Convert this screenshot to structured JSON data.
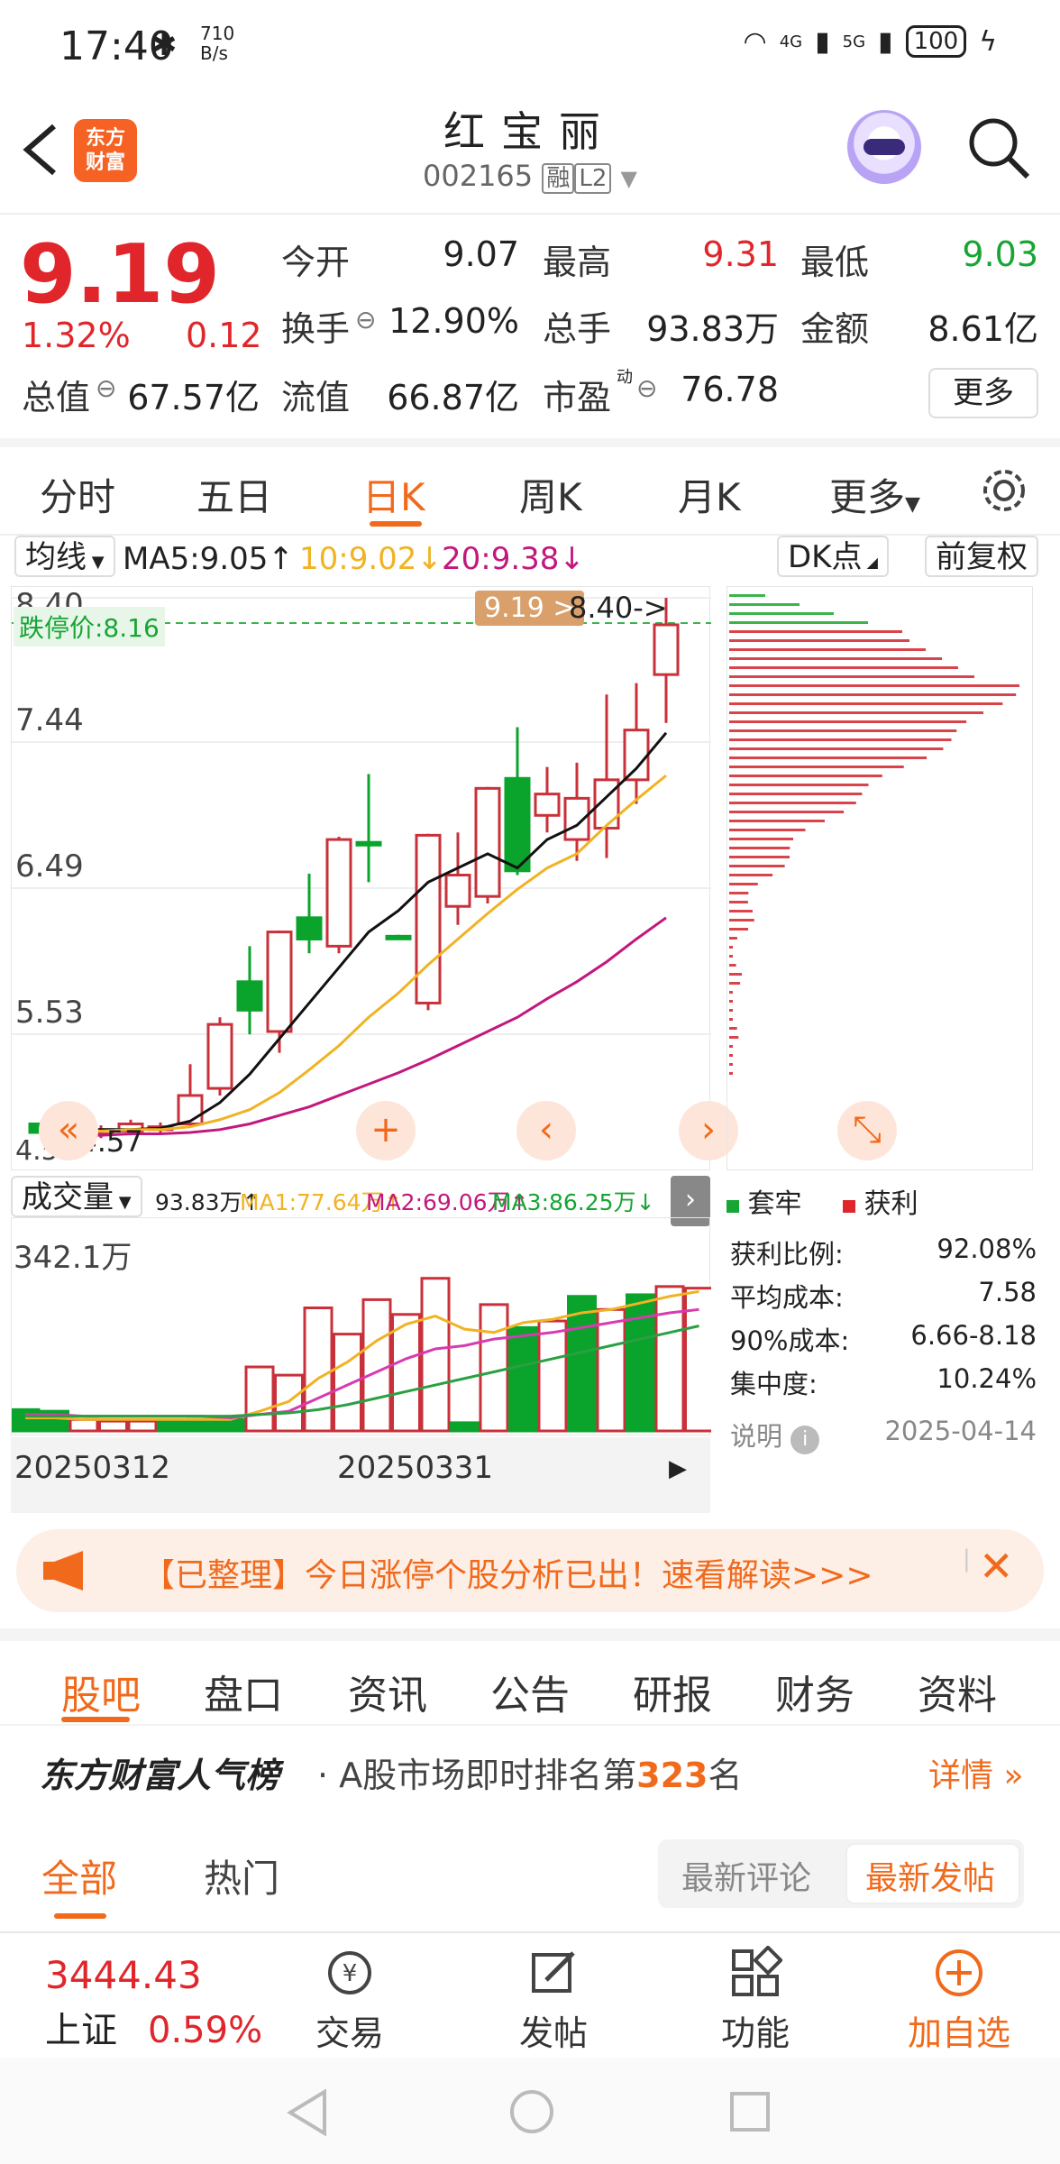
{
  "status": {
    "time": "17:40",
    "net_speed": "710\nB/s",
    "battery": "100",
    "sig1": "4G",
    "sig2": "5G"
  },
  "header": {
    "logo_line1": "东方",
    "logo_line2": "财富",
    "name": "红宝丽",
    "code": "002165",
    "tag1": "融",
    "tag2": "L2"
  },
  "quote": {
    "price": "9.19",
    "pct": "1.32%",
    "change": "0.12",
    "rows": [
      {
        "l1": "今开",
        "v1": "9.07",
        "l2": "最高",
        "v2": "9.31",
        "l3": "最低",
        "v3": "9.03"
      },
      {
        "l1": "换手",
        "v1": "12.90%",
        "l2": "总手",
        "v2": "93.83万",
        "l3": "金额",
        "v3": "8.61亿"
      },
      {
        "l1": "总值",
        "v1": "67.57亿",
        "l2": "流值",
        "v2": "66.87亿",
        "l3": "市盈",
        "v3": "76.78"
      }
    ],
    "pe_sup": "动",
    "more": "更多"
  },
  "periods": [
    "分时",
    "五日",
    "日K",
    "周K",
    "月K",
    "更多"
  ],
  "ma_row": {
    "select": "均线",
    "ma5": "MA5:9.05↑",
    "ma10": "10:9.02↓",
    "ma20": "20:9.38↓",
    "dk": "DK点",
    "fq": "前复权"
  },
  "kchart": {
    "y_labels": [
      "8.40",
      "7.44",
      "6.49",
      "5.53",
      "4.57"
    ],
    "limit_down": "跌停价:8.16",
    "price_tag": "9.19 >",
    "high_tag": "8.40->",
    "low_tag": "<-4.57"
  },
  "chart_data": {
    "type": "candlestick",
    "y_range": [
      4.57,
      8.4
    ],
    "candles": [
      {
        "o": 4.64,
        "c": 4.7,
        "h": 4.72,
        "l": 4.6,
        "up": false
      },
      {
        "o": 4.62,
        "c": 4.65,
        "h": 4.68,
        "l": 4.58,
        "up": true
      },
      {
        "o": 4.63,
        "c": 4.66,
        "h": 4.69,
        "l": 4.6,
        "up": true
      },
      {
        "o": 4.65,
        "c": 4.7,
        "h": 4.73,
        "l": 4.62,
        "up": true
      },
      {
        "o": 4.66,
        "c": 4.68,
        "h": 4.71,
        "l": 4.63,
        "up": true
      },
      {
        "o": 4.7,
        "c": 4.9,
        "h": 5.12,
        "l": 4.68,
        "up": true
      },
      {
        "o": 4.95,
        "c": 5.4,
        "h": 5.45,
        "l": 4.9,
        "up": true
      },
      {
        "o": 5.7,
        "c": 5.5,
        "h": 5.95,
        "l": 5.33,
        "up": false
      },
      {
        "o": 5.35,
        "c": 6.05,
        "h": 6.06,
        "l": 5.2,
        "up": true
      },
      {
        "o": 6.15,
        "c": 6.0,
        "h": 6.46,
        "l": 5.9,
        "up": false
      },
      {
        "o": 5.95,
        "c": 6.7,
        "h": 6.72,
        "l": 5.9,
        "up": true
      },
      {
        "o": 6.68,
        "c": 6.68,
        "h": 7.16,
        "l": 6.4,
        "up": false
      },
      {
        "o": 6.02,
        "c": 6.02,
        "h": 6.03,
        "l": 6.0,
        "up": false
      },
      {
        "o": 5.55,
        "c": 6.73,
        "h": 6.74,
        "l": 5.5,
        "up": true
      },
      {
        "o": 6.23,
        "c": 6.45,
        "h": 6.75,
        "l": 6.1,
        "up": true
      },
      {
        "o": 6.3,
        "c": 7.06,
        "h": 7.07,
        "l": 6.25,
        "up": true
      },
      {
        "o": 7.13,
        "c": 6.48,
        "h": 7.49,
        "l": 6.45,
        "up": false
      },
      {
        "o": 7.02,
        "c": 6.87,
        "h": 7.21,
        "l": 6.75,
        "up": true
      },
      {
        "o": 6.7,
        "c": 6.99,
        "h": 7.24,
        "l": 6.55,
        "up": true
      },
      {
        "o": 6.78,
        "c": 7.12,
        "h": 7.72,
        "l": 6.57,
        "up": true
      },
      {
        "o": 7.12,
        "c": 7.47,
        "h": 7.8,
        "l": 6.95,
        "up": true
      },
      {
        "o": 7.86,
        "c": 8.21,
        "h": 8.4,
        "l": 7.52,
        "up": true
      }
    ],
    "ma5": [
      4.66,
      4.66,
      4.66,
      4.66,
      4.67,
      4.72,
      4.85,
      5.05,
      5.3,
      5.55,
      5.8,
      6.05,
      6.2,
      6.4,
      6.5,
      6.6,
      6.5,
      6.7,
      6.8,
      7.0,
      7.2,
      7.45
    ],
    "ma10": [
      4.65,
      4.65,
      4.65,
      4.66,
      4.66,
      4.68,
      4.73,
      4.8,
      4.92,
      5.08,
      5.25,
      5.45,
      5.62,
      5.82,
      6.0,
      6.18,
      6.35,
      6.5,
      6.6,
      6.8,
      6.98,
      7.15
    ],
    "ma20": [
      4.62,
      4.62,
      4.62,
      4.63,
      4.63,
      4.64,
      4.66,
      4.7,
      4.76,
      4.82,
      4.9,
      4.98,
      5.06,
      5.15,
      5.25,
      5.35,
      5.45,
      5.58,
      5.7,
      5.84,
      6.0,
      6.15
    ],
    "volume": {
      "max_label": "342.1万",
      "values": [
        0.13,
        0.12,
        0.07,
        0.06,
        0.06,
        0.06,
        0.07,
        0.07,
        0.39,
        0.34,
        0.75,
        0.59,
        0.8,
        0.71,
        0.93,
        0.05,
        0.77,
        0.63,
        0.67,
        0.82,
        0.74,
        0.83,
        0.88,
        0.87
      ],
      "up": [
        false,
        false,
        true,
        true,
        true,
        false,
        false,
        false,
        true,
        true,
        true,
        true,
        true,
        true,
        true,
        false,
        true,
        false,
        true,
        false,
        true,
        false,
        true,
        true
      ],
      "ma1": [
        0.08,
        0.08,
        0.07,
        0.07,
        0.07,
        0.07,
        0.07,
        0.07,
        0.12,
        0.18,
        0.32,
        0.42,
        0.55,
        0.65,
        0.7,
        0.62,
        0.6,
        0.66,
        0.68,
        0.72,
        0.74,
        0.78,
        0.82,
        0.85
      ],
      "ma2": [
        0.1,
        0.1,
        0.09,
        0.09,
        0.09,
        0.09,
        0.09,
        0.08,
        0.1,
        0.12,
        0.2,
        0.28,
        0.36,
        0.44,
        0.5,
        0.52,
        0.56,
        0.58,
        0.6,
        0.63,
        0.66,
        0.69,
        0.72,
        0.74
      ],
      "ma3": [
        0.09,
        0.09,
        0.09,
        0.09,
        0.09,
        0.09,
        0.09,
        0.09,
        0.1,
        0.11,
        0.13,
        0.16,
        0.2,
        0.24,
        0.28,
        0.32,
        0.36,
        0.4,
        0.44,
        0.48,
        0.52,
        0.56,
        0.6,
        0.64
      ]
    },
    "x_labels": [
      "20250312",
      "20250331"
    ]
  },
  "vol_row": {
    "select": "成交量",
    "vol": "93.83万↑",
    "ma1": "MA1:77.64万↑",
    "ma2": "MA2:69.06万↑",
    "ma3": "MA3:86.25万↓"
  },
  "profile": {
    "legend_trapped": "套牢",
    "legend_profit": "获利",
    "stats": [
      {
        "label": "获利比例:",
        "value": "92.08%"
      },
      {
        "label": "平均成本:",
        "value": "7.58"
      },
      {
        "label": "90%成本:",
        "value": "6.66-8.18"
      },
      {
        "label": "集中度:",
        "value": "10.24%"
      }
    ],
    "note": "说明",
    "date": "2025-04-14"
  },
  "banner": {
    "text": "【已整理】今日涨停个股分析已出！速看解读>>>"
  },
  "subtabs": [
    "股吧",
    "盘口",
    "资讯",
    "公告",
    "研报",
    "财务",
    "资料"
  ],
  "hot": {
    "brand": "东方财富人气榜",
    "text_pre": "· A股市场即时排名第",
    "rank": "323",
    "text_post": "名",
    "detail": "详情"
  },
  "post_tabs": {
    "all": "全部",
    "hot": "热门",
    "latest_comment": "最新评论",
    "latest_post": "最新发帖"
  },
  "bottom": {
    "index_value": "3444.43",
    "index_name": "上证",
    "index_pct": "0.59%",
    "trade": "交易",
    "post": "发帖",
    "func": "功能",
    "add": "加自选"
  }
}
